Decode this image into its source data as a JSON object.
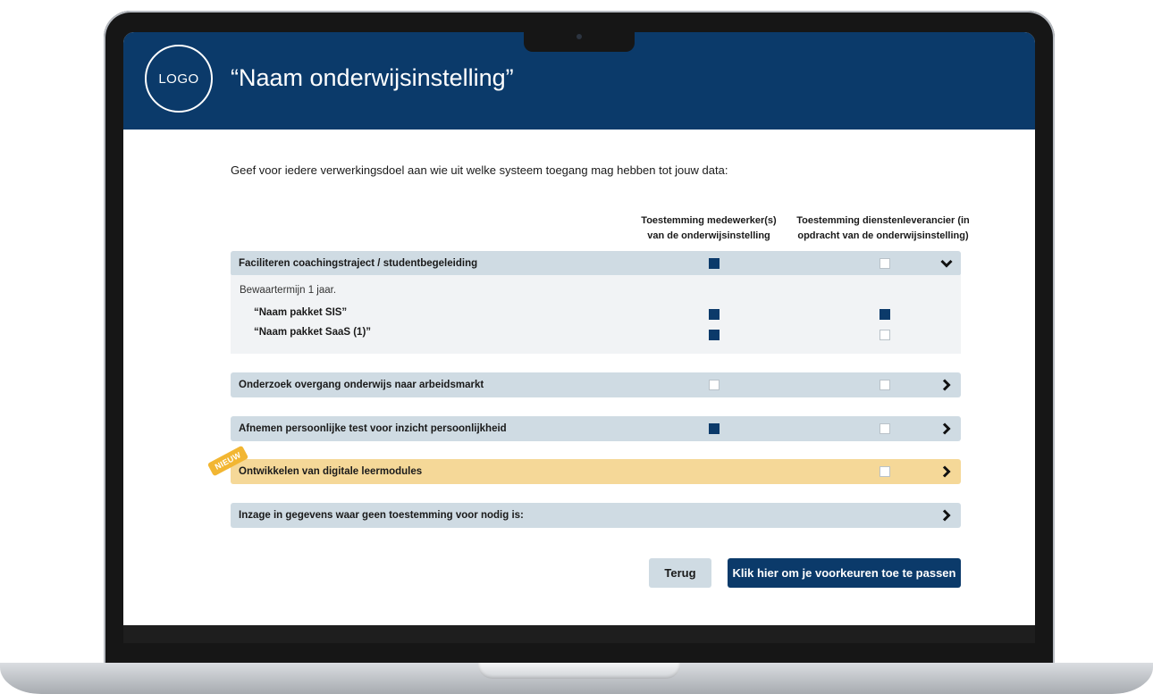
{
  "header": {
    "logo_text": "LOGO",
    "title": "“Naam onderwijsinstelling”"
  },
  "intro_text": "Geef voor iedere verwerkingsdoel aan wie uit welke systeem toegang mag hebben tot jouw data:",
  "columns": {
    "col1_line1": "Toestemming medewerker(s)",
    "col1_line2": "van de onderwijsinstelling",
    "col2_line1": "Toestemming dienstenleverancier (in",
    "col2_line2": "opdracht van de onderwijsinstelling)"
  },
  "purposes": [
    {
      "label": "Faciliteren coachingstraject / studentbegeleiding",
      "employee_consent": true,
      "provider_consent": false,
      "expanded": true,
      "retention": "Bewaartermijn 1 jaar.",
      "packages": [
        {
          "label": "“Naam pakket SIS”",
          "employee_consent": true,
          "provider_consent": true
        },
        {
          "label": "“Naam pakket SaaS (1)”",
          "employee_consent": true,
          "provider_consent": false
        }
      ]
    },
    {
      "label": "Onderzoek overgang onderwijs naar arbeidsmarkt",
      "employee_consent": false,
      "provider_consent": false,
      "expanded": false
    },
    {
      "label": "Afnemen persoonlijke test voor inzicht persoonlijkheid",
      "employee_consent": true,
      "provider_consent": false,
      "expanded": false
    },
    {
      "label": "Ontwikkelen van digitale leermodules",
      "badge": "NIEUW",
      "provider_consent": false,
      "expanded": false
    },
    {
      "label": "Inzage in gegevens waar geen toestemming voor nodig is:",
      "expanded": false
    }
  ],
  "buttons": {
    "back_label": "Terug",
    "apply_label": "Klik hier om je voorkeuren toe te passen"
  },
  "colors": {
    "brand_navy": "#0b3a6a",
    "row_bg": "#cfdbe3",
    "new_row_bg": "#f5d898",
    "badge": "#f2b632"
  },
  "icons": {
    "expanded": "chevron-down-icon",
    "collapsed": "chevron-right-icon"
  }
}
